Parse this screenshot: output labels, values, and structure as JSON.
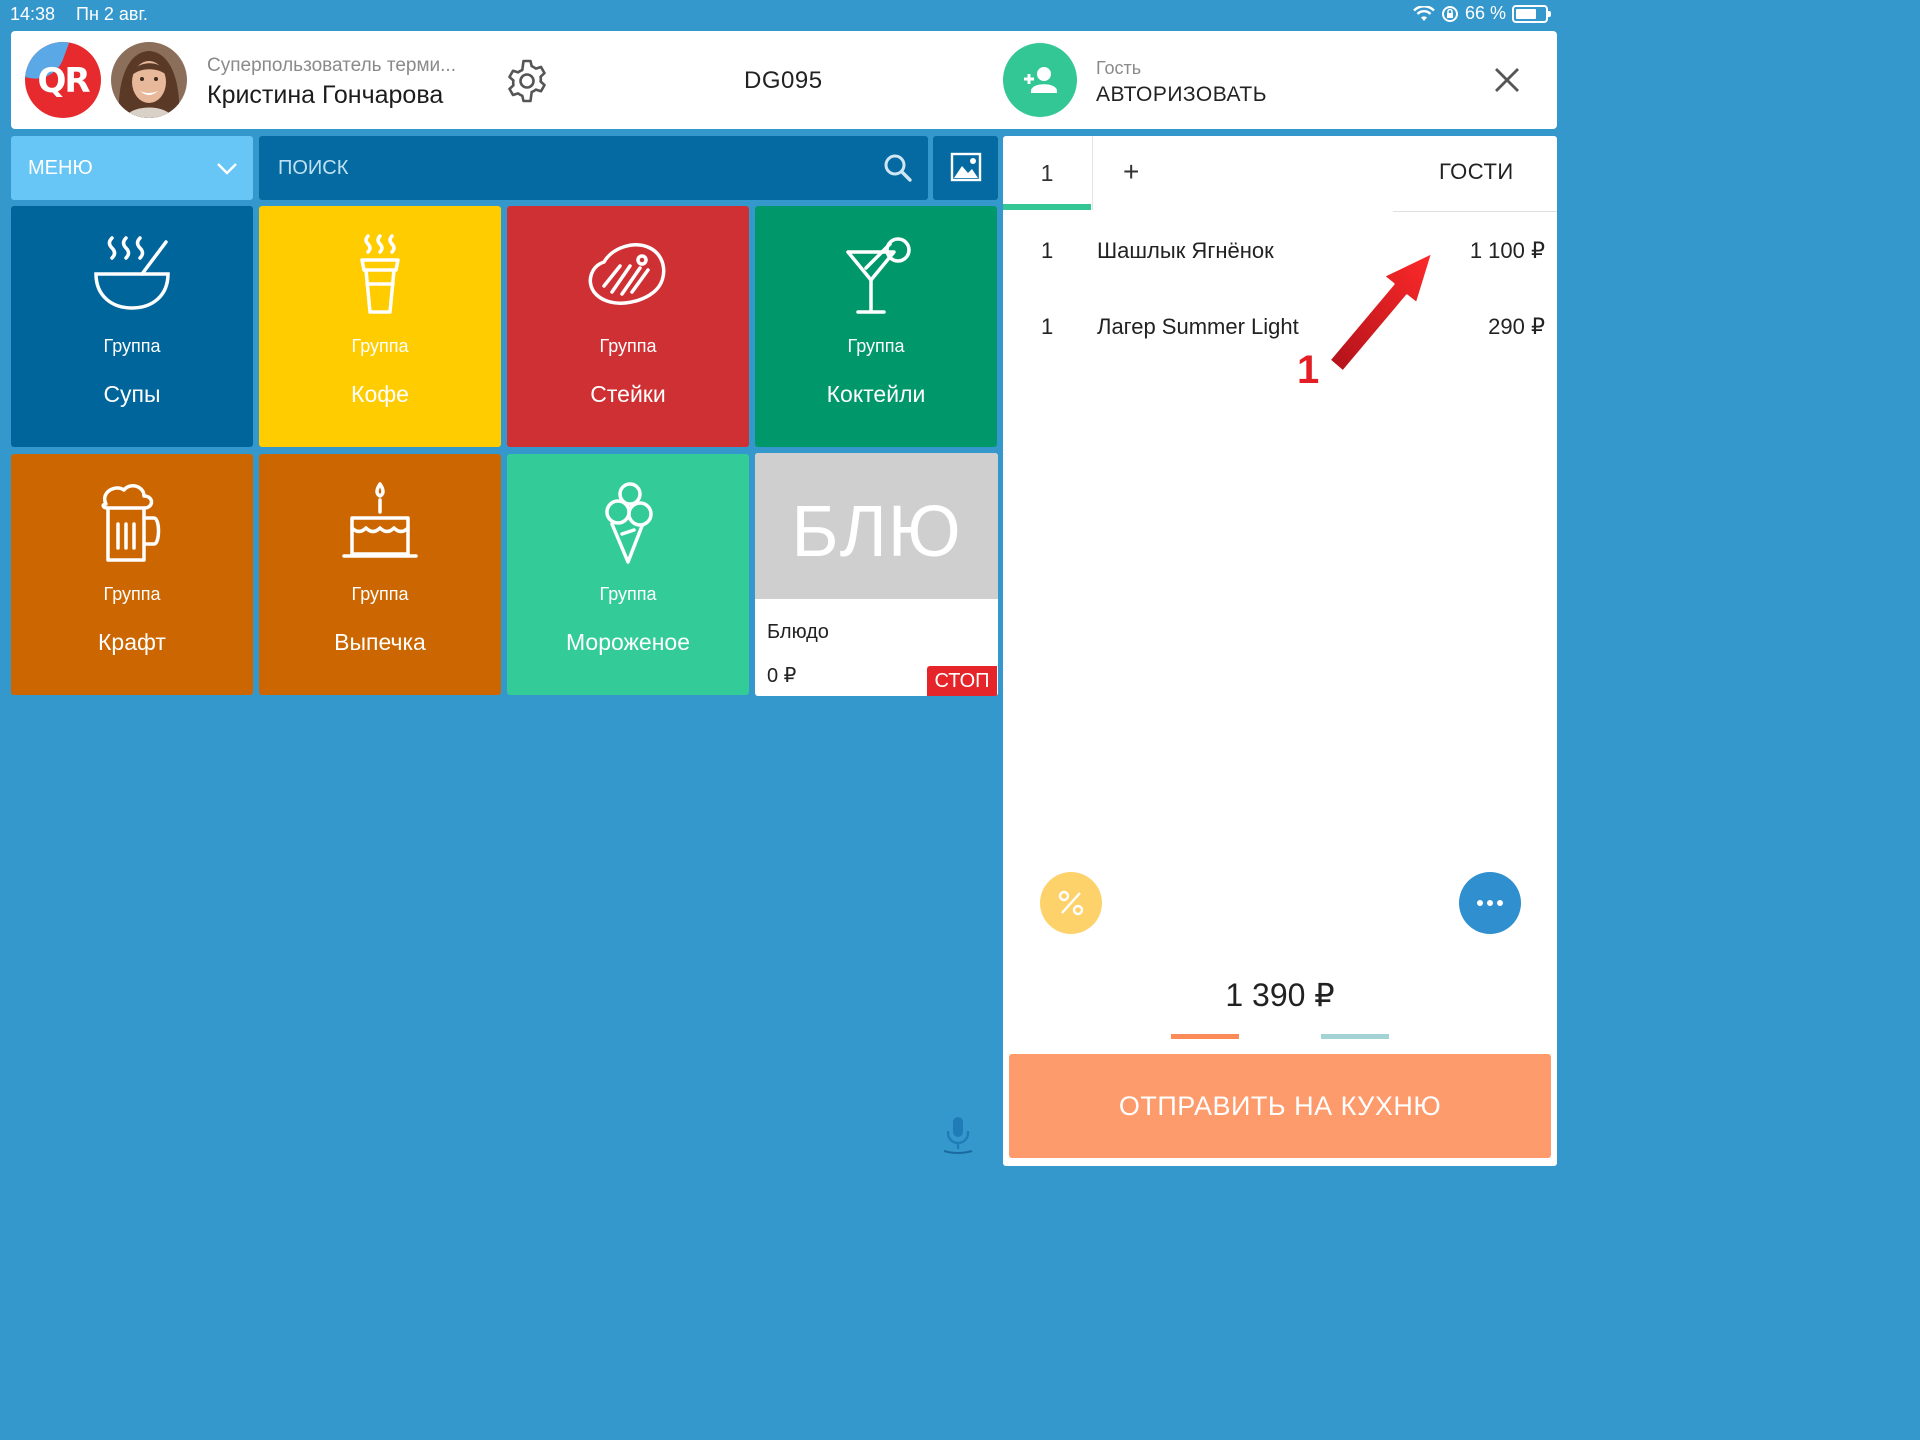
{
  "status_bar": {
    "time": "14:38",
    "date": "Пн 2 авг.",
    "battery_percent": "66 %"
  },
  "header": {
    "user_role": "Суперпользователь терми...",
    "user_name": "Кристина Гончарова",
    "terminal_code": "DG095",
    "guest_label": "Гость",
    "guest_action": "АВТОРИЗОВАТЬ",
    "logo_text": "QR"
  },
  "menu": {
    "dropdown_label": "МЕНЮ",
    "search_placeholder": "ПОИСК"
  },
  "tiles": [
    {
      "group": "Группа",
      "name": "Супы",
      "color": "#00659b",
      "icon": "soup-bowl-icon"
    },
    {
      "group": "Группа",
      "name": "Кофе",
      "color": "#ffcc00",
      "icon": "coffee-cup-icon"
    },
    {
      "group": "Группа",
      "name": "Стейки",
      "color": "#cf3033",
      "icon": "steak-icon"
    },
    {
      "group": "Группа",
      "name": "Коктейли",
      "color": "#00986a",
      "icon": "cocktail-icon"
    },
    {
      "group": "Группа",
      "name": "Крафт",
      "color": "#cc6600",
      "icon": "beer-mug-icon"
    },
    {
      "group": "Группа",
      "name": "Выпечка",
      "color": "#cc6600",
      "icon": "cake-icon"
    },
    {
      "group": "Группа",
      "name": "Мороженое",
      "color": "#33cc99",
      "icon": "ice-cream-icon"
    }
  ],
  "dish": {
    "placeholder": "БЛЮ",
    "name": "Блюдо",
    "price": "0 ₽",
    "stop_label": "СТОП"
  },
  "order": {
    "tab_number": "1",
    "add_tab": "+",
    "guests_label": "ГОСТИ",
    "items": [
      {
        "qty": "1",
        "name": "Шашлык Ягнёнок",
        "price": "1 100 ₽"
      },
      {
        "qty": "1",
        "name": "Лагер Summer Light",
        "price": "290 ₽"
      }
    ],
    "annotation_number": "1",
    "total": "1 390 ₽",
    "send_button": "ОТПРАВИТЬ НА КУХНЮ"
  },
  "colors": {
    "background": "#3598cd",
    "accent_green": "#34c796",
    "send_button": "#fd9b6c",
    "stop_red": "#e5252a",
    "discount_yellow": "#fdd26b",
    "more_blue": "#2f8fcf"
  }
}
